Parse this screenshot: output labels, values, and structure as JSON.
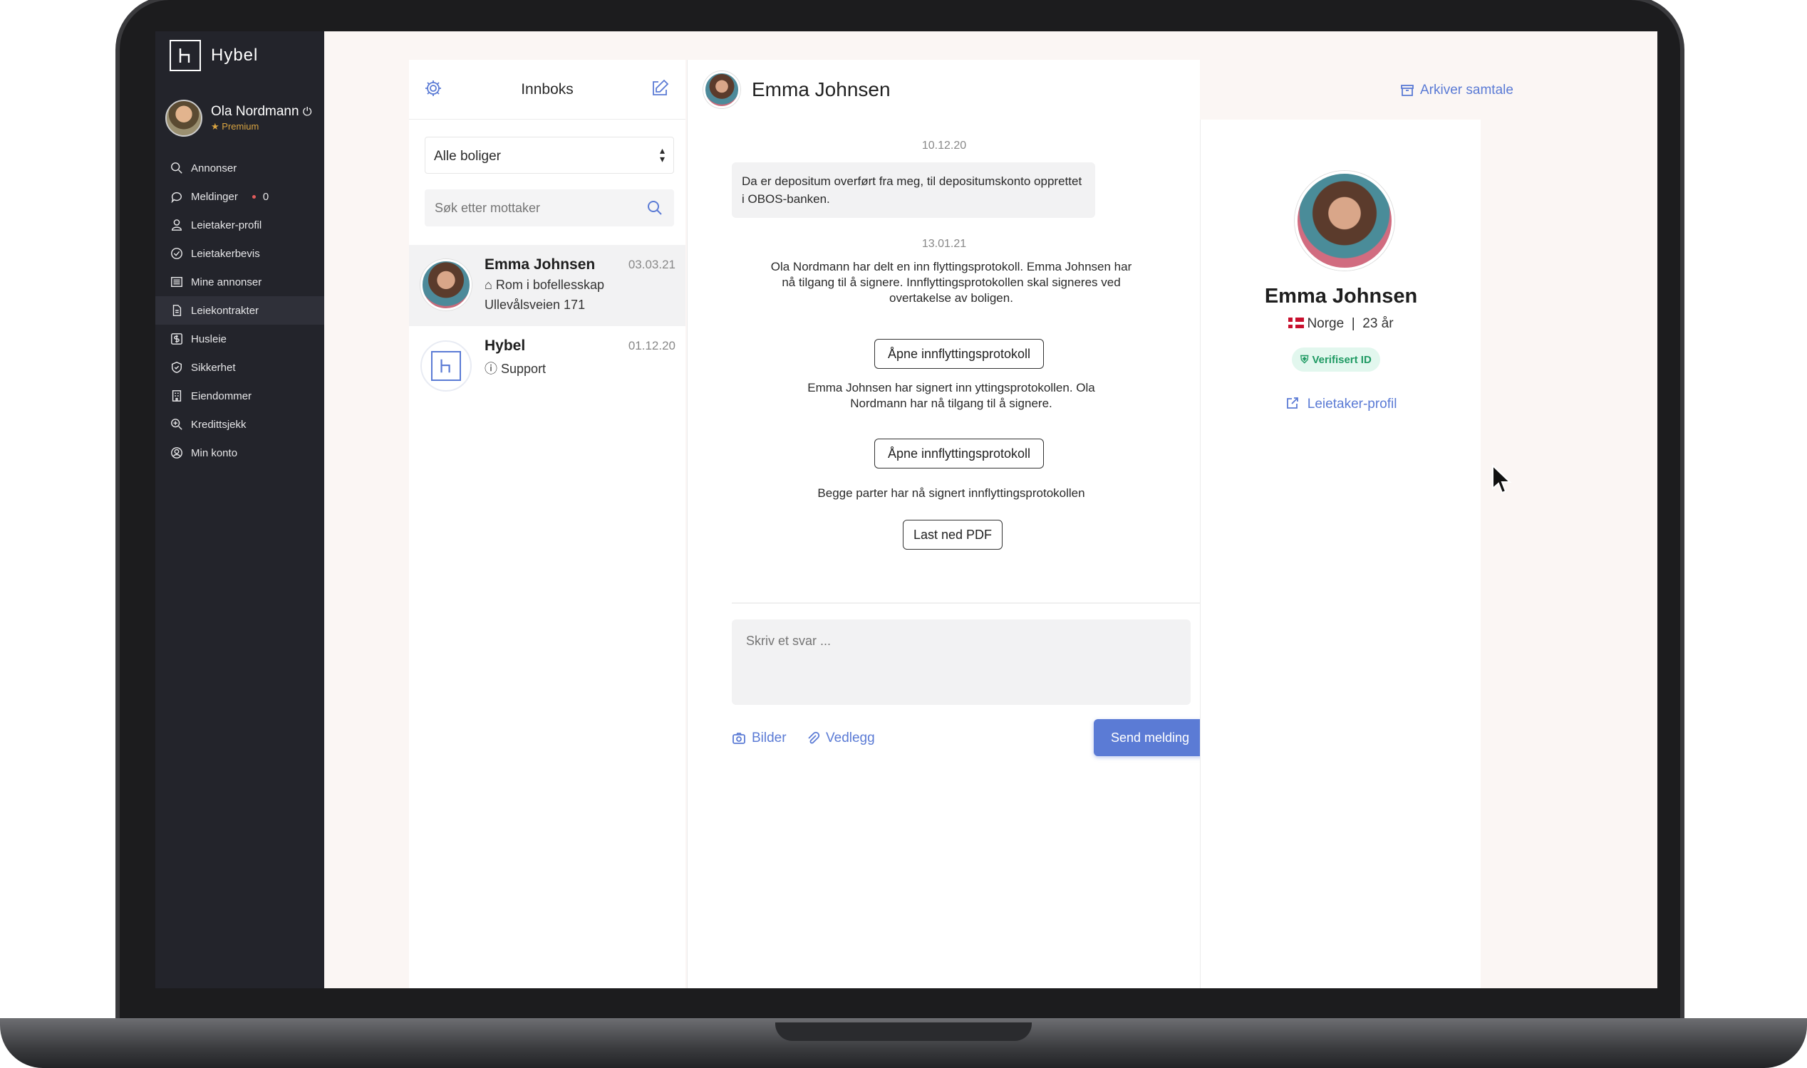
{
  "app": {
    "name": "Hybel",
    "user_name": "Ola Nordmann",
    "user_badge": "Premium"
  },
  "nav": [
    {
      "label": "Annonser",
      "icon": "search-icon"
    },
    {
      "label": "Meldinger",
      "icon": "chat-icon",
      "count": "0"
    },
    {
      "label": "Leietaker-profil",
      "icon": "user-icon"
    },
    {
      "label": "Leietakerbevis",
      "icon": "check-circle-icon"
    },
    {
      "label": "Mine annonser",
      "icon": "list-icon"
    },
    {
      "label": "Leiekontrakter",
      "icon": "document-icon",
      "active": true
    },
    {
      "label": "Husleie",
      "icon": "dollar-icon"
    },
    {
      "label": "Sikkerhet",
      "icon": "shield-icon"
    },
    {
      "label": "Eiendommer",
      "icon": "building-icon"
    },
    {
      "label": "Kredittsjekk",
      "icon": "zoom-icon"
    },
    {
      "label": "Min konto",
      "icon": "account-icon"
    }
  ],
  "inbox": {
    "title": "Innboks",
    "filter_value": "Alle boliger",
    "search_placeholder": "Søk etter mottaker",
    "conversations": [
      {
        "name": "Emma Johnsen",
        "date": "03.03.21",
        "line1": "Rom i bofellesskap",
        "line2": "Ullevålsveien 171"
      },
      {
        "name": "Hybel",
        "date": "01.12.20",
        "line1": "Support"
      }
    ]
  },
  "chat": {
    "title": "Emma Johnsen",
    "archive_label": "Arkiver samtale",
    "date1": "10.12.20",
    "bubble_text": "Da er depositum overført fra meg, til depositumskonto opprettet i OBOS-banken.",
    "date2": "13.01.21",
    "sys1": "Ola Nordmann har delt en inn flyttingsprotokoll. Emma Johnsen har nå tilgang til å signere. Innflyttingsprotokollen skal signeres ved overtakelse av boligen.",
    "btn1": "Åpne innflyttingsprotokoll",
    "sys2": "Emma Johnsen har signert inn yttingsprotokollen. Ola Nordmann har nå tilgang til å signere.",
    "btn2": "Åpne innflyttingsprotokoll",
    "sys3": "Begge parter har nå signert innflyttingsprotokollen",
    "btn3": "Last ned PDF",
    "reply_placeholder": "Skriv et svar ...",
    "images_label": "Bilder",
    "attach_label": "Vedlegg",
    "send_label": "Send melding"
  },
  "profile": {
    "name": "Emma Johnsen",
    "country": "Norge",
    "separator": "|",
    "age": "23 år",
    "verified": "Verifisert ID",
    "link": "Leietaker-profil"
  },
  "colors": {
    "accent": "#5b7bd5",
    "sidebar": "#23242b",
    "verified": "#1f9a63"
  }
}
